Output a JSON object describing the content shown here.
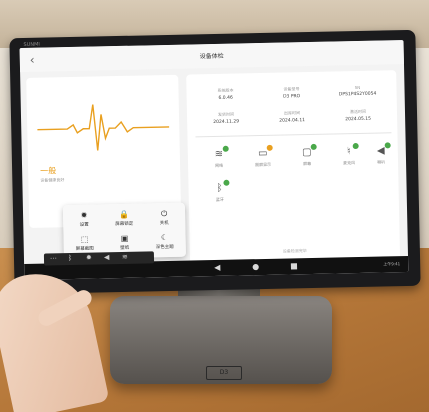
{
  "screen": {
    "title": "设备体检",
    "back_icon": "‹",
    "brand": "SUNMI"
  },
  "score": {
    "value": "一般",
    "label": "设备健康良好"
  },
  "info": [
    {
      "label": "系统版本",
      "value": "6.0.46"
    },
    {
      "label": "设备型号",
      "value": "D3 PRO"
    },
    {
      "label": "SN",
      "value": "DPS1P4S2Y0054"
    },
    {
      "label": "发货时间",
      "value": "2024.11.29"
    },
    {
      "label": "出库时间",
      "value": "2024.04.11"
    },
    {
      "label": "激活时间",
      "value": "2024.05.15"
    }
  ],
  "features": [
    {
      "icon": "wifi-icon",
      "glyph": "≋",
      "name": "网络",
      "status": "ok"
    },
    {
      "icon": "display-icon",
      "glyph": "▭",
      "name": "副屏显示",
      "status": "warn"
    },
    {
      "icon": "screen-icon",
      "glyph": "▢",
      "name": "屏幕",
      "status": "ok"
    },
    {
      "icon": "microphone-icon",
      "glyph": "♮",
      "name": "麦克风",
      "status": "ok"
    },
    {
      "icon": "speaker-icon",
      "glyph": "◀",
      "name": "喇叭",
      "status": "ok"
    },
    {
      "icon": "bluetooth-icon",
      "glyph": "ᛒ",
      "name": "蓝牙",
      "status": "ok"
    }
  ],
  "footnote": "设备检测完毕",
  "quick_panel": [
    {
      "icon": "gear-icon",
      "glyph": "✹",
      "name": "设置"
    },
    {
      "icon": "lock-icon",
      "glyph": "🔒",
      "name": "屏幕锁定"
    },
    {
      "icon": "power-icon",
      "glyph": "⏻",
      "name": "关机"
    },
    {
      "icon": "screenshot-icon",
      "glyph": "⬚",
      "name": "屏幕截图"
    },
    {
      "icon": "wallpaper-icon",
      "glyph": "▣",
      "name": "壁纸"
    },
    {
      "icon": "dark-mode-icon",
      "glyph": "☾",
      "name": "深色主题"
    }
  ],
  "navbar": {
    "back": "◀",
    "home": "●",
    "recent": "■",
    "time": "上午9:41"
  },
  "colors": {
    "accent": "#e9a020",
    "ok": "#4aa84a"
  }
}
